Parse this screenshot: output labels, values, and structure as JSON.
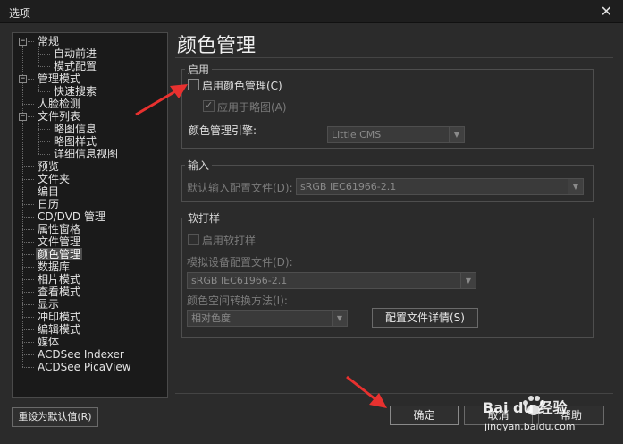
{
  "window": {
    "title": "选项",
    "close_glyph": "✕"
  },
  "tree": {
    "expander_minus": "−",
    "items": [
      {
        "label": "常规",
        "indent": 0,
        "expander": true
      },
      {
        "label": "自动前进",
        "indent": 1
      },
      {
        "label": "模式配置",
        "indent": 1
      },
      {
        "label": "管理模式",
        "indent": 0,
        "expander": true
      },
      {
        "label": "快速搜索",
        "indent": 1
      },
      {
        "label": "人脸检测",
        "indent": 0
      },
      {
        "label": "文件列表",
        "indent": 0,
        "expander": true
      },
      {
        "label": "略图信息",
        "indent": 1
      },
      {
        "label": "略图样式",
        "indent": 1
      },
      {
        "label": "详细信息视图",
        "indent": 1
      },
      {
        "label": "预览",
        "indent": 0
      },
      {
        "label": "文件夹",
        "indent": 0
      },
      {
        "label": "编目",
        "indent": 0
      },
      {
        "label": "日历",
        "indent": 0
      },
      {
        "label": "CD/DVD 管理",
        "indent": 0
      },
      {
        "label": "属性窗格",
        "indent": 0
      },
      {
        "label": "文件管理",
        "indent": 0
      },
      {
        "label": "颜色管理",
        "indent": 0,
        "selected": true
      },
      {
        "label": "数据库",
        "indent": 0
      },
      {
        "label": "相片模式",
        "indent": 0
      },
      {
        "label": "查看模式",
        "indent": 0
      },
      {
        "label": "显示",
        "indent": 0
      },
      {
        "label": "冲印模式",
        "indent": 0
      },
      {
        "label": "编辑模式",
        "indent": 0
      },
      {
        "label": "媒体",
        "indent": 0
      },
      {
        "label": "ACDSee Indexer",
        "indent": 0
      },
      {
        "label": "ACDSee PicaView",
        "indent": 0
      }
    ]
  },
  "panel": {
    "title": "颜色管理",
    "enable_group": {
      "label": "启用",
      "enable_cm_label": "启用颜色管理(C)",
      "apply_thumb_label": "应用于略图(A)",
      "checkmark": "✓",
      "engine_label": "颜色管理引擎:",
      "engine_value": "Little CMS"
    },
    "input_group": {
      "label": "输入",
      "default_profile_label": "默认输入配置文件(D):",
      "default_profile_value": "sRGB IEC61966-2.1"
    },
    "proof_group": {
      "label": "软打样",
      "enable_proof_label": "启用软打样",
      "device_profile_label": "模拟设备配置文件(D):",
      "device_profile_value": "sRGB IEC61966-2.1",
      "intent_label": "颜色空间转换方法(I):",
      "intent_value": "相对色度",
      "profile_details_button": "配置文件详情(S)"
    }
  },
  "footer": {
    "reset_button": "重设为默认值(R)",
    "ok_button": "确定",
    "cancel_button": "取消",
    "help_button": "帮助"
  },
  "watermark": {
    "brand": "Bai du 经验",
    "url": "jingyan.baidu.com"
  },
  "colors": {
    "accent_arrow": "#e8312f",
    "background": "#2b2b2b",
    "selection": "#4d4d4d"
  },
  "combo_arrow_glyph": "▼"
}
